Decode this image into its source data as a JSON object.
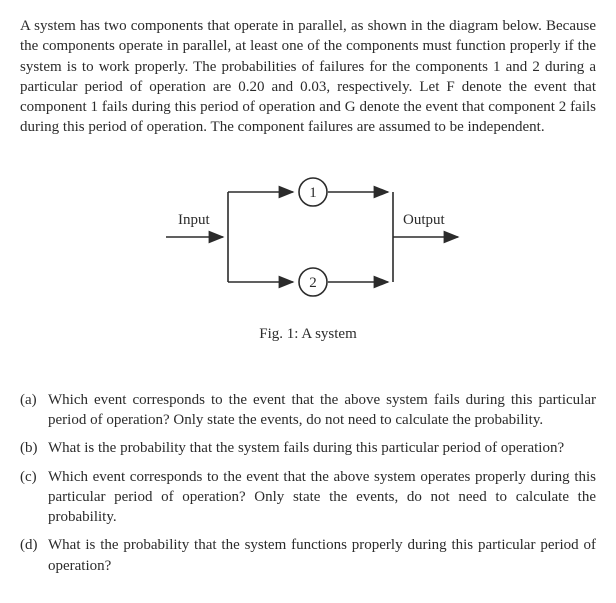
{
  "intro": "A system has two components that operate in parallel, as shown in the diagram below. Because the components operate in parallel, at least one of the components must function properly if the system is to work properly.  The probabilities of failures for the components 1 and 2 during a particular period of operation are 0.20 and 0.03, respectively.  Let F denote the event that component 1 fails during this period of operation and G denote the event that component 2 fails during this period of operation. The component failures are assumed to be independent.",
  "figure": {
    "input_label": "Input",
    "output_label": "Output",
    "node1": "1",
    "node2": "2",
    "caption": "Fig. 1: A system"
  },
  "questions": [
    {
      "label": "(a)",
      "text": "Which event corresponds to the event that the above system fails during this particular period of operation? Only state the events, do not need to calculate the probability."
    },
    {
      "label": "(b)",
      "text": "What is the probability that the system fails during this particular period of operation?"
    },
    {
      "label": "(c)",
      "text": "Which event corresponds to the event that the above system operates properly during this particular period of operation? Only state the events, do not need to calculate the probability."
    },
    {
      "label": "(d)",
      "text": "What is the probability that the system functions properly during this particular period of operation?"
    }
  ]
}
